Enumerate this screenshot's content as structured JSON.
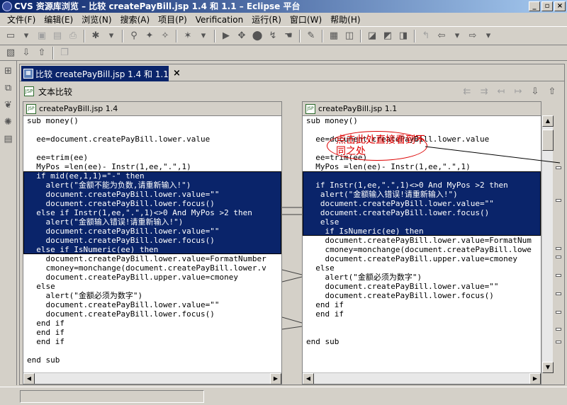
{
  "window": {
    "title": "CVS 资源库浏览 – 比较 createPayBill.jsp 1.4 和 1.1 – Eclipse 平台",
    "buttons": [
      "_",
      "▫",
      "×"
    ]
  },
  "menu": [
    "文件(F)",
    "编辑(E)",
    "浏览(N)",
    "搜索(A)",
    "项目(P)",
    "Verification",
    "运行(R)",
    "窗口(W)",
    "帮助(H)"
  ],
  "editor_tab": {
    "label": "比较 createPayBill.jsp 1.4 和 1.1",
    "close": "×"
  },
  "compare_header": "文本比较",
  "left_pane": {
    "title": "createPayBill.jsp 1.4",
    "lines": [
      "sub money()",
      "",
      "  ee=document.createPayBill.lower.value",
      "",
      "  ee=trim(ee)",
      "  MyPos =len(ee)- Instr(1,ee,\".\",1)",
      "  if mid(ee,1,1)=\"-\" then",
      "    alert(\"金额不能为负数,请重新输入!\")",
      "    document.createPayBill.lower.value=\"\"",
      "    document.createPayBill.lower.focus()",
      "  else if Instr(1,ee,\".\",1)<>0 And MyPos >2 then",
      "    alert(\"金额输入错误!请重新输入!\")",
      "    document.createPayBill.lower.value=\"\"",
      "    document.createPayBill.lower.focus()",
      "  else if IsNumeric(ee) then",
      "    document.createPayBill.lower.value=FormatNumber",
      "    cmoney=monchange(document.createPayBill.lower.v",
      "    document.createPayBill.upper.value=cmoney",
      "  else",
      "    alert(\"金额必须为数字\")",
      "    document.createPayBill.lower.value=\"\"",
      "    document.createPayBill.lower.focus()",
      "  end if",
      "  end if",
      "  end if",
      "",
      "end sub"
    ]
  },
  "right_pane": {
    "title": "createPayBill.jsp 1.1",
    "lines": [
      "sub money()",
      "",
      "  ee=document.createPayBill.lower.value",
      "",
      "  ee=trim(ee)",
      "  MyPos =len(ee)- Instr(1,ee,\".\",1)",
      "",
      "  if Instr(1,ee,\".\",1)<>0 And MyPos >2 then",
      "   alert(\"金额输入错误!请重新输入!\")",
      "   document.createPayBill.lower.value=\"\"",
      "   document.createPayBill.lower.focus()",
      "   else",
      "    if IsNumeric(ee) then",
      "    document.createPayBill.lower.value=FormatNum",
      "    cmoney=monchange(document.createPayBill.lowe",
      "    document.createPayBill.upper.value=cmoney",
      "  else",
      "    alert(\"金额必须为数字\")",
      "    document.createPayBill.lower.value=\"\"",
      "    document.createPayBill.lower.focus()",
      "  end if",
      "  end if",
      "",
      "",
      "end sub"
    ]
  },
  "callout": "点击此处直接看到不同之处",
  "colors": {
    "selection": "#0a246a",
    "callout": "#dd0000",
    "titlebar": "#0a246a"
  }
}
